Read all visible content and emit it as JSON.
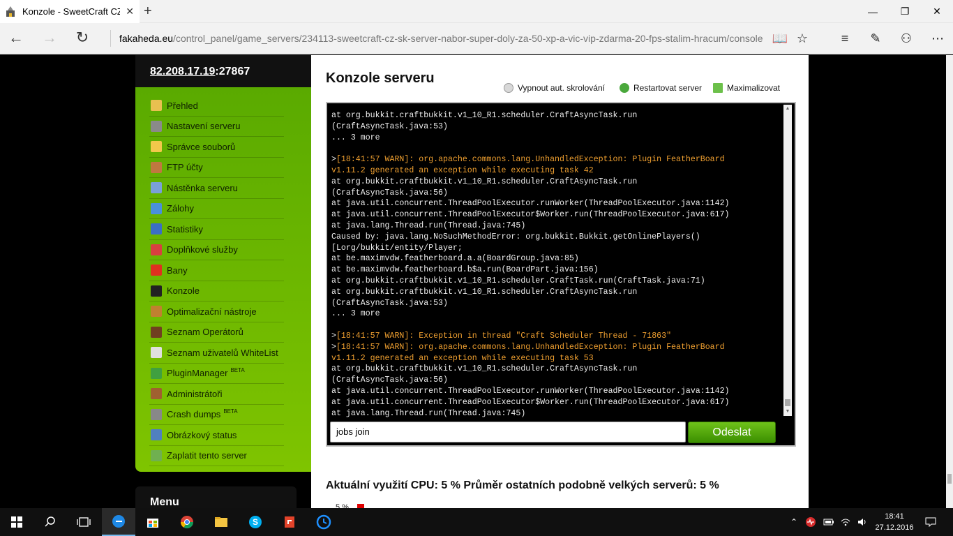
{
  "browser": {
    "tab_title": "Konzole - SweetCraft CZ",
    "url_host": "fakaheda.eu",
    "url_path": "/control_panel/game_servers/234113-sweetcraft-cz-sk-server-nabor-super-doly-za-50-xp-a-vic-vip-zdarma-20-fps-stalim-hracum/console"
  },
  "sidebar": {
    "ip": "82.208.17.19",
    "port": ":27867",
    "items": [
      {
        "label": "Přehled",
        "badge": "",
        "color": "#e8c050"
      },
      {
        "label": "Nastavení serveru",
        "badge": "",
        "color": "#8a8a8a"
      },
      {
        "label": "Správce souborů",
        "badge": "",
        "color": "#f2c84b"
      },
      {
        "label": "FTP účty",
        "badge": "",
        "color": "#c07840"
      },
      {
        "label": "Nástěnka serveru",
        "badge": "",
        "color": "#7aa0d8"
      },
      {
        "label": "Zálohy",
        "badge": "",
        "color": "#4a90d9"
      },
      {
        "label": "Statistiky",
        "badge": "",
        "color": "#3b6fc4"
      },
      {
        "label": "Doplňkové služby",
        "badge": "",
        "color": "#d94040"
      },
      {
        "label": "Bany",
        "badge": "",
        "color": "#e03020"
      },
      {
        "label": "Konzole",
        "badge": "",
        "color": "#222222"
      },
      {
        "label": "Optimalizační nástroje",
        "badge": "",
        "color": "#c08030"
      },
      {
        "label": "Seznam Operátorů",
        "badge": "",
        "color": "#704020"
      },
      {
        "label": "Seznam uživatelů WhiteList",
        "badge": "",
        "color": "#e0e0e0"
      },
      {
        "label": "PluginManager",
        "badge": "BETA",
        "color": "#40a040"
      },
      {
        "label": "Administrátoři",
        "badge": "",
        "color": "#a06030"
      },
      {
        "label": "Crash dumps",
        "badge": "BETA",
        "color": "#888888"
      },
      {
        "label": "Obrázkový status",
        "badge": "",
        "color": "#5080c0"
      },
      {
        "label": "Zaplatit tento server",
        "badge": "",
        "color": "#70b050"
      }
    ],
    "menu_heading": "Menu"
  },
  "main": {
    "heading": "Konzole serveru",
    "actions": {
      "stop_scroll": "Vypnout aut. skrolování",
      "restart": "Restartovat server",
      "maximize": "Maximalizovat"
    },
    "console_lines": [
      {
        "t": "at org.bukkit.craftbukkit.v1_10_R1.scheduler.CraftAsyncTask.run",
        "w": false
      },
      {
        "t": "(CraftAsyncTask.java:53)",
        "w": false
      },
      {
        "t": "... 3 more",
        "w": false
      },
      {
        "t": "",
        "w": false
      },
      {
        "t": "[18:41:57 WARN]: org.apache.commons.lang.UnhandledException: Plugin FeatherBoard",
        "w": true,
        "p": ">"
      },
      {
        "t": "v1.11.2 generated an exception while executing task 42",
        "w": true
      },
      {
        "t": "at org.bukkit.craftbukkit.v1_10_R1.scheduler.CraftAsyncTask.run",
        "w": false
      },
      {
        "t": "(CraftAsyncTask.java:56)",
        "w": false
      },
      {
        "t": "at java.util.concurrent.ThreadPoolExecutor.runWorker(ThreadPoolExecutor.java:1142)",
        "w": false
      },
      {
        "t": "at java.util.concurrent.ThreadPoolExecutor$Worker.run(ThreadPoolExecutor.java:617)",
        "w": false
      },
      {
        "t": "at java.lang.Thread.run(Thread.java:745)",
        "w": false
      },
      {
        "t": "Caused by: java.lang.NoSuchMethodError: org.bukkit.Bukkit.getOnlinePlayers()",
        "w": false
      },
      {
        "t": "[Lorg/bukkit/entity/Player;",
        "w": false
      },
      {
        "t": "at be.maximvdw.featherboard.a.a(BoardGroup.java:85)",
        "w": false
      },
      {
        "t": "at be.maximvdw.featherboard.b$a.run(BoardPart.java:156)",
        "w": false
      },
      {
        "t": "at org.bukkit.craftbukkit.v1_10_R1.scheduler.CraftTask.run(CraftTask.java:71)",
        "w": false
      },
      {
        "t": "at org.bukkit.craftbukkit.v1_10_R1.scheduler.CraftAsyncTask.run",
        "w": false
      },
      {
        "t": "(CraftAsyncTask.java:53)",
        "w": false
      },
      {
        "t": "... 3 more",
        "w": false
      },
      {
        "t": "",
        "w": false
      },
      {
        "t": "[18:41:57 WARN]: Exception in thread \"Craft Scheduler Thread - 71863\"",
        "w": true,
        "p": ">"
      },
      {
        "t": "[18:41:57 WARN]: org.apache.commons.lang.UnhandledException: Plugin FeatherBoard",
        "w": true,
        "p": ">"
      },
      {
        "t": "v1.11.2 generated an exception while executing task 53",
        "w": true
      },
      {
        "t": "at org.bukkit.craftbukkit.v1_10_R1.scheduler.CraftAsyncTask.run",
        "w": false
      },
      {
        "t": "(CraftAsyncTask.java:56)",
        "w": false
      },
      {
        "t": "at java.util.concurrent.ThreadPoolExecutor.runWorker(ThreadPoolExecutor.java:1142)",
        "w": false
      },
      {
        "t": "at java.util.concurrent.ThreadPoolExecutor$Worker.run(ThreadPoolExecutor.java:617)",
        "w": false
      },
      {
        "t": "at java.lang.Thread.run(Thread.java:745)",
        "w": false
      }
    ],
    "command_value": "jobs join",
    "send_label": "Odeslat",
    "cpu_text": "Aktuální využití CPU: 5 % Průměr ostatních podobně velkých serverů: 5 %",
    "cpu_small": "5 %"
  },
  "taskbar": {
    "time": "18:41",
    "date": "27.12.2016"
  }
}
